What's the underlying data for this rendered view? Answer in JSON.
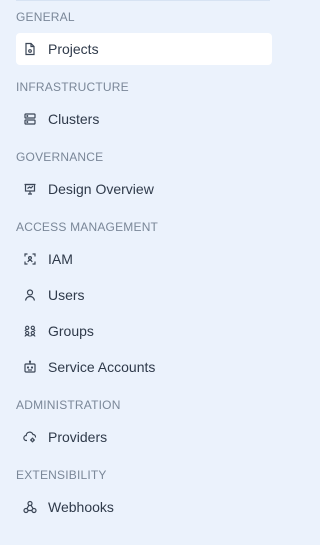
{
  "sidebar": {
    "sections": [
      {
        "title": "GENERAL",
        "items": [
          {
            "label": "Projects",
            "icon": "file-settings-icon",
            "active": true
          }
        ]
      },
      {
        "title": "INFRASTRUCTURE",
        "items": [
          {
            "label": "Clusters",
            "icon": "server-icon"
          }
        ]
      },
      {
        "title": "GOVERNANCE",
        "items": [
          {
            "label": "Design Overview",
            "icon": "presentation-icon"
          }
        ]
      },
      {
        "title": "ACCESS MANAGEMENT",
        "items": [
          {
            "label": "IAM",
            "icon": "scan-face-icon"
          },
          {
            "label": "Users",
            "icon": "user-icon"
          },
          {
            "label": "Groups",
            "icon": "users-group-icon"
          },
          {
            "label": "Service Accounts",
            "icon": "bot-icon"
          }
        ]
      },
      {
        "title": "ADMINISTRATION",
        "items": [
          {
            "label": "Providers",
            "icon": "cloud-cog-icon"
          }
        ]
      },
      {
        "title": "EXTENSIBILITY",
        "items": [
          {
            "label": "Webhooks",
            "icon": "webhook-icon"
          }
        ]
      }
    ]
  },
  "colors": {
    "background": "#ebf2fc",
    "active_item": "#ffffff",
    "section_text": "#7a8798",
    "item_text": "#2f3a4a"
  }
}
